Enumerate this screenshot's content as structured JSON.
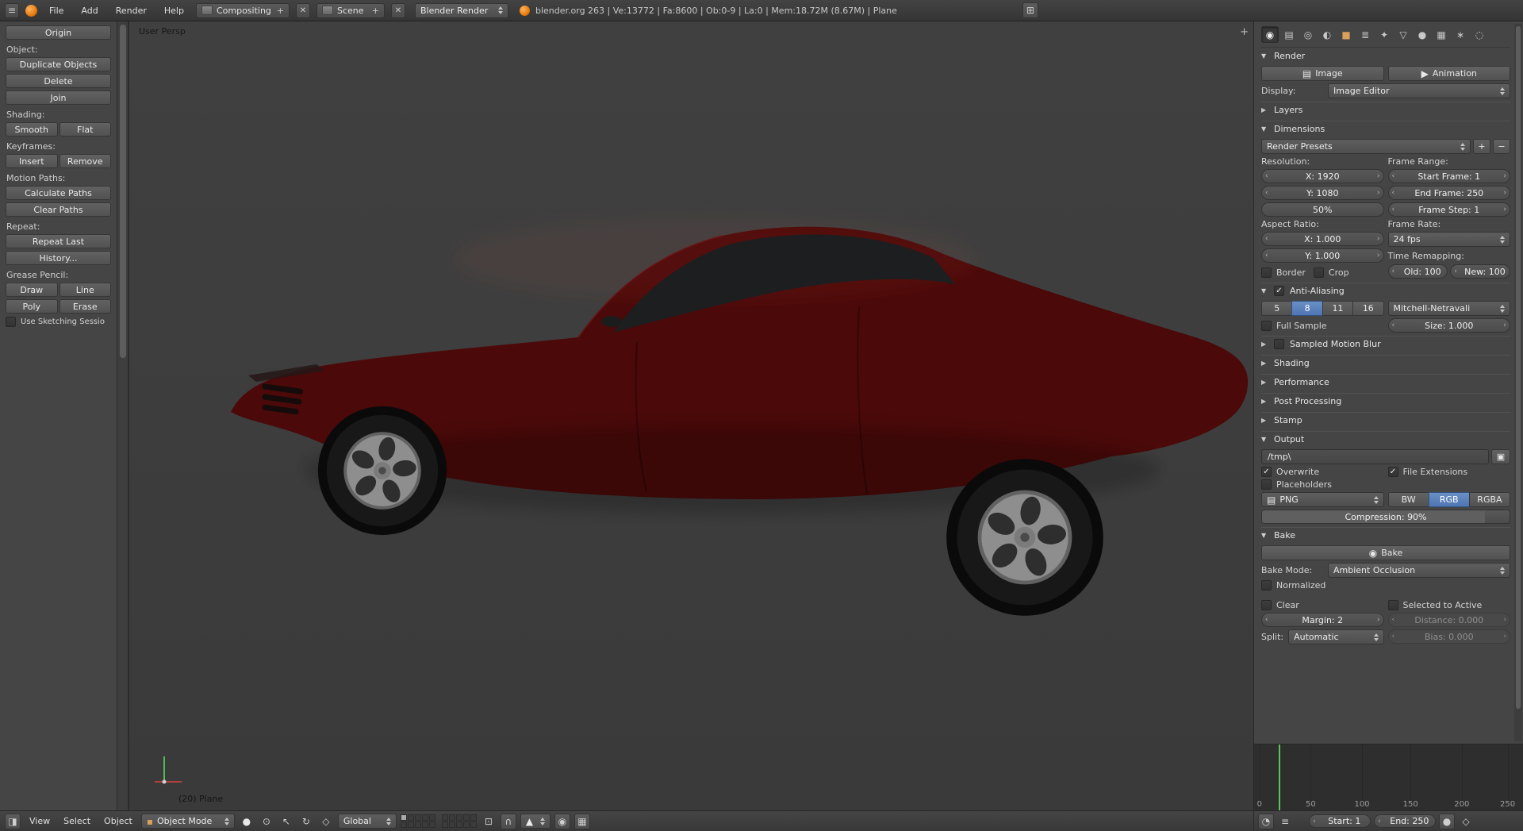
{
  "top_header": {
    "menus": [
      "File",
      "Add",
      "Render",
      "Help"
    ],
    "screen_layout": "Compositing",
    "scene": "Scene",
    "render_engine": "Blender Render",
    "status": "blender.org 263 | Ve:13772 | Fa:8600 | Ob:0-9 | La:0 | Mem:18.72M (8.67M) | Plane"
  },
  "tool_shelf": {
    "origin": "Origin",
    "object_label": "Object:",
    "duplicate": "Duplicate Objects",
    "delete": "Delete",
    "join": "Join",
    "shading_label": "Shading:",
    "smooth": "Smooth",
    "flat": "Flat",
    "keyframes_label": "Keyframes:",
    "insert": "Insert",
    "remove": "Remove",
    "motion_paths_label": "Motion Paths:",
    "calculate_paths": "Calculate Paths",
    "clear_paths": "Clear Paths",
    "repeat_label": "Repeat:",
    "repeat_last": "Repeat Last",
    "history": "History...",
    "grease_pencil_label": "Grease Pencil:",
    "draw": "Draw",
    "line": "Line",
    "poly": "Poly",
    "erase": "Erase",
    "use_sketching": "Use Sketching Sessio"
  },
  "viewport": {
    "view_label": "User Persp",
    "object_info": "(20) Plane"
  },
  "viewport_header": {
    "menus": [
      "View",
      "Select",
      "Object"
    ],
    "mode": "Object Mode",
    "orientation": "Global"
  },
  "properties": {
    "render_section": {
      "title": "Render",
      "image": "Image",
      "animation": "Animation",
      "display_label": "Display:",
      "display_value": "Image Editor"
    },
    "layers_title": "Layers",
    "dimensions": {
      "title": "Dimensions",
      "presets": "Render Presets",
      "resolution_label": "Resolution:",
      "frame_range_label": "Frame Range:",
      "res_x": "X: 1920",
      "res_y": "Y: 1080",
      "res_pct": "50%",
      "start_frame": "Start Frame: 1",
      "end_frame": "End Frame: 250",
      "frame_step": "Frame Step: 1",
      "aspect_label": "Aspect Ratio:",
      "frame_rate_label": "Frame Rate:",
      "aspect_x": "X: 1.000",
      "aspect_y": "Y: 1.000",
      "fps": "24 fps",
      "border": "Border",
      "crop": "Crop",
      "time_remap_label": "Time Remapping:",
      "old": "Old: 100",
      "new": "New: 100"
    },
    "anti_aliasing": {
      "title": "Anti-Aliasing",
      "samples": [
        "5",
        "8",
        "11",
        "16"
      ],
      "filter": "Mitchell-Netravali",
      "full_sample": "Full Sample",
      "size": "Size: 1.000"
    },
    "collapsed": {
      "sampled_motion_blur": "Sampled Motion Blur",
      "shading": "Shading",
      "performance": "Performance",
      "post_processing": "Post Processing",
      "stamp": "Stamp"
    },
    "output": {
      "title": "Output",
      "path": "/tmp\\",
      "overwrite": "Overwrite",
      "file_extensions": "File Extensions",
      "placeholders": "Placeholders",
      "format": "PNG",
      "bw": "BW",
      "rgb": "RGB",
      "rgba": "RGBA",
      "compression": "Compression: 90%"
    },
    "bake": {
      "title": "Bake",
      "bake_button": "Bake",
      "bake_mode_label": "Bake Mode:",
      "bake_mode": "Ambient Occlusion",
      "normalized": "Normalized",
      "clear": "Clear",
      "selected_to_active": "Selected to Active",
      "margin": "Margin: 2",
      "distance": "Distance: 0.000",
      "split_label": "Split:",
      "split": "Automatic",
      "bias": "Bias: 0.000"
    }
  },
  "timeline": {
    "ticks": [
      "0",
      "50",
      "100",
      "150",
      "200",
      "250"
    ],
    "start": "Start: 1",
    "end": "End: 250"
  }
}
